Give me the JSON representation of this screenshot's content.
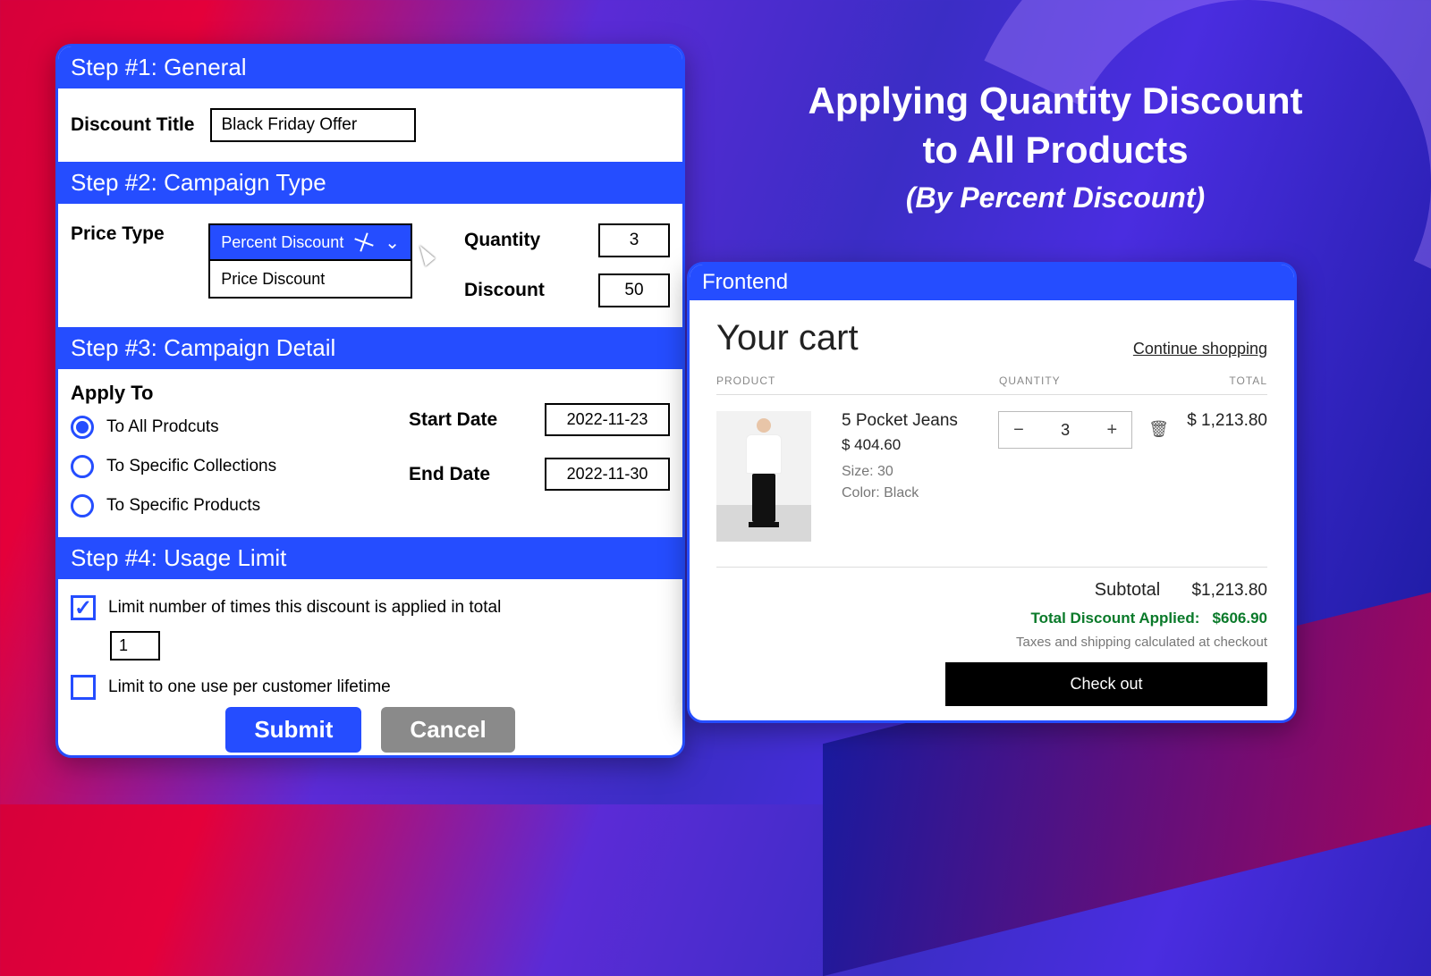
{
  "headline": {
    "line1": "Applying Quantity Discount",
    "line2": "to All Products",
    "sub": "(By Percent Discount)"
  },
  "steps": {
    "s1": {
      "title": "Step #1: General",
      "discount_title_label": "Discount Title",
      "discount_title_value": "Black Friday Offer"
    },
    "s2": {
      "title": "Step #2: Campaign Type",
      "price_type_label": "Price Type",
      "dd_selected": "Percent Discount",
      "dd_option": "Price Discount",
      "quantity_label": "Quantity",
      "quantity_value": "3",
      "discount_label": "Discount",
      "discount_value": "50"
    },
    "s3": {
      "title": "Step #3: Campaign Detail",
      "apply_to_label": "Apply To",
      "radios": {
        "all": "To All Prodcuts",
        "collections": "To Specific Collections",
        "products": "To Specific Products"
      },
      "start_label": "Start Date",
      "start_value": "2022-11-23",
      "end_label": "End Date",
      "end_value": "2022-11-30"
    },
    "s4": {
      "title": "Step #4: Usage Limit",
      "limit_total_label": "Limit number of times this discount is applied in total",
      "limit_total_value": "1",
      "limit_customer_label": "Limit to one use per customer lifetime"
    },
    "buttons": {
      "submit": "Submit",
      "cancel": "Cancel"
    }
  },
  "frontend": {
    "title": "Frontend",
    "cart_title": "Your cart",
    "continue": "Continue shopping",
    "headers": {
      "product": "PRODUCT",
      "quantity": "QUANTITY",
      "total": "TOTAL"
    },
    "item": {
      "name": "5 Pocket Jeans",
      "price": "$ 404.60",
      "size": "Size: 30",
      "color": "Color: Black",
      "qty": "3",
      "line_total": "$ 1,213.80"
    },
    "subtotal_label": "Subtotal",
    "subtotal_value": "$1,213.80",
    "discount_label": "Total Discount Applied:",
    "discount_value": "$606.90",
    "tax_note": "Taxes and shipping calculated at checkout",
    "checkout": "Check out"
  }
}
